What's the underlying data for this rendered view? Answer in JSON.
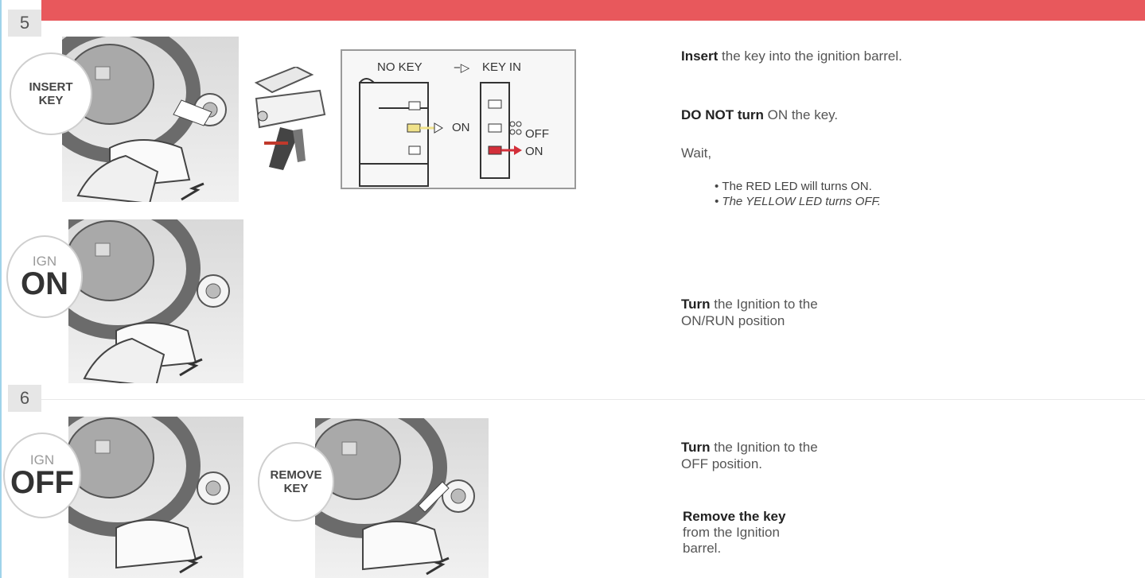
{
  "steps": [
    {
      "number": "5"
    },
    {
      "number": "6"
    }
  ],
  "badges": {
    "insert_key": {
      "line1": "INSERT",
      "line2": "KEY"
    },
    "ign_on": {
      "small": "IGN",
      "big": "ON"
    },
    "ign_off": {
      "small": "IGN",
      "big": "OFF"
    },
    "remove_key": {
      "line1": "REMOVE",
      "line2": "KEY"
    }
  },
  "diagram": {
    "no_key": "NO KEY",
    "key_in": "KEY IN",
    "arrow_symbol": "−▷",
    "on_left": "ON",
    "off": "OFF",
    "on_right": "ON"
  },
  "instructions": {
    "insert": {
      "bold": "Insert",
      "rest": " the key into the ignition barrel."
    },
    "do_not": {
      "bold": "DO NOT turn",
      "rest": " ON the key."
    },
    "wait": "Wait,",
    "bullets": [
      "The RED LED will turns ON.",
      "The YELLOW LED turns OFF."
    ],
    "turn_on": {
      "bold": "Turn",
      "rest1": " the Ignition to the",
      "rest2": "ON/RUN position"
    },
    "turn_off": {
      "bold": "Turn",
      "rest1": " the Ignition to the",
      "rest2": "OFF position."
    },
    "remove": {
      "bold": "Remove the key",
      "rest1": "from the Ignition",
      "rest2": "barrel."
    }
  },
  "colors": {
    "banner": "#e8585c",
    "led_red": "#d32f3a",
    "led_yellow": "#f0e28a"
  }
}
